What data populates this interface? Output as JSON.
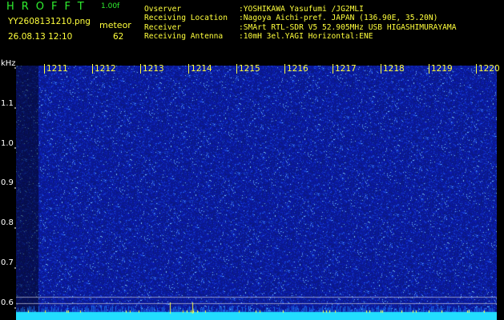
{
  "header": {
    "app_title": "HROFFT",
    "version": "1.00f",
    "filename": "YY2608131210.png",
    "timestamp": "26.08.13 12:10",
    "detect_label": "meteor",
    "detect_count": "62"
  },
  "info": [
    {
      "label": "Ovserver",
      "value": ":YOSHIKAWA Yasufumi /JG2MLI"
    },
    {
      "label": "Receiving Location",
      "value": ":Nagoya Aichi-pref. JAPAN (136.90E, 35.20N)"
    },
    {
      "label": "Receiver",
      "value": ":SMArt RTL-SDR V5 52.905MHz USB HIGASHIMURAYAMA"
    },
    {
      "label": "Receiving Antenna",
      "value": ":10mH 3el.YAGI Horizontal:ENE"
    }
  ],
  "axis": {
    "unit": "kHz",
    "y_labels": [
      "1.1",
      "1.0",
      "0.9",
      "0.8",
      "0.7",
      "0.6"
    ],
    "time_labels": [
      "1211",
      "1212",
      "1213",
      "1214",
      "1215",
      "1216",
      "1217",
      "1218",
      "1219",
      "1220"
    ]
  },
  "colors": {
    "title": "#2ff02f",
    "text": "#ffff3c",
    "background": "#000000",
    "waterfall_base": "#0a1fa0",
    "baseline": "#22ddff"
  }
}
